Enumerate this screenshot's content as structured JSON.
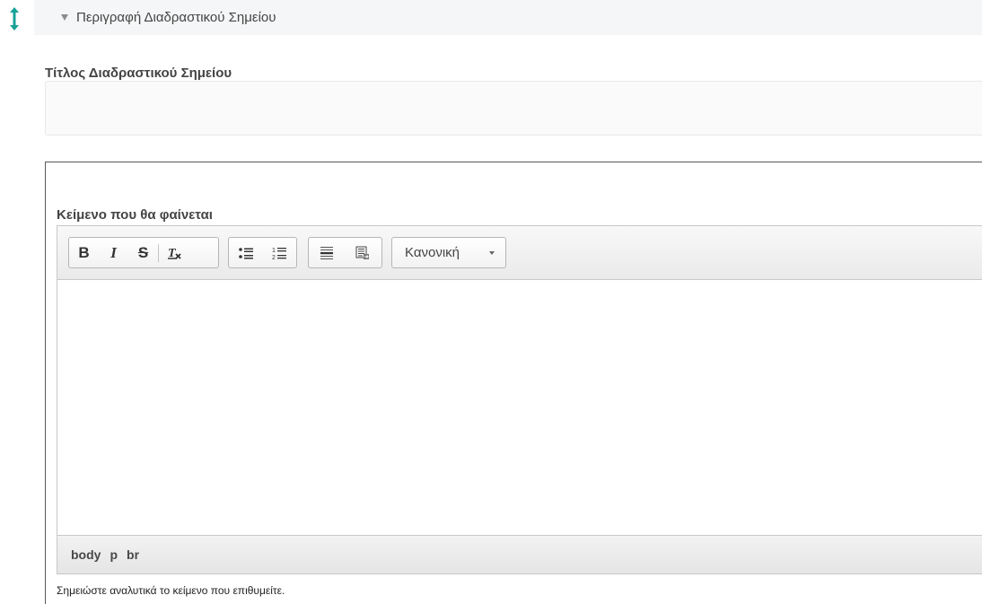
{
  "colors": {
    "drag_handle": "#1aa198",
    "header_bg": "#f5f6f7"
  },
  "group": {
    "title": "Περιγραφή Διαδραστικού Σημείου",
    "drag_icon": "vertical-arrows-icon",
    "caret_icon": "caret-down-icon"
  },
  "title_field": {
    "label": "Τίτλος Διαδραστικού Σημείου",
    "value": ""
  },
  "text_field": {
    "label": "Κείμενο που θα φαίνεται",
    "toolbar": {
      "bold": "B",
      "italic": "I",
      "strike": "S",
      "remove_format_icon": "remove-format-icon",
      "bulleted_list_icon": "bulleted-list-icon",
      "numbered_list_icon": "numbered-list-icon",
      "horizontal_rule_icon": "horizontal-rule-icon",
      "paste_text_icon": "paste-text-icon",
      "format": "Κανονική"
    },
    "content": "",
    "path": [
      "body",
      "p",
      "br"
    ],
    "help": "Σημειώστε αναλυτικά το κείμενο που επιθυμείτε."
  }
}
